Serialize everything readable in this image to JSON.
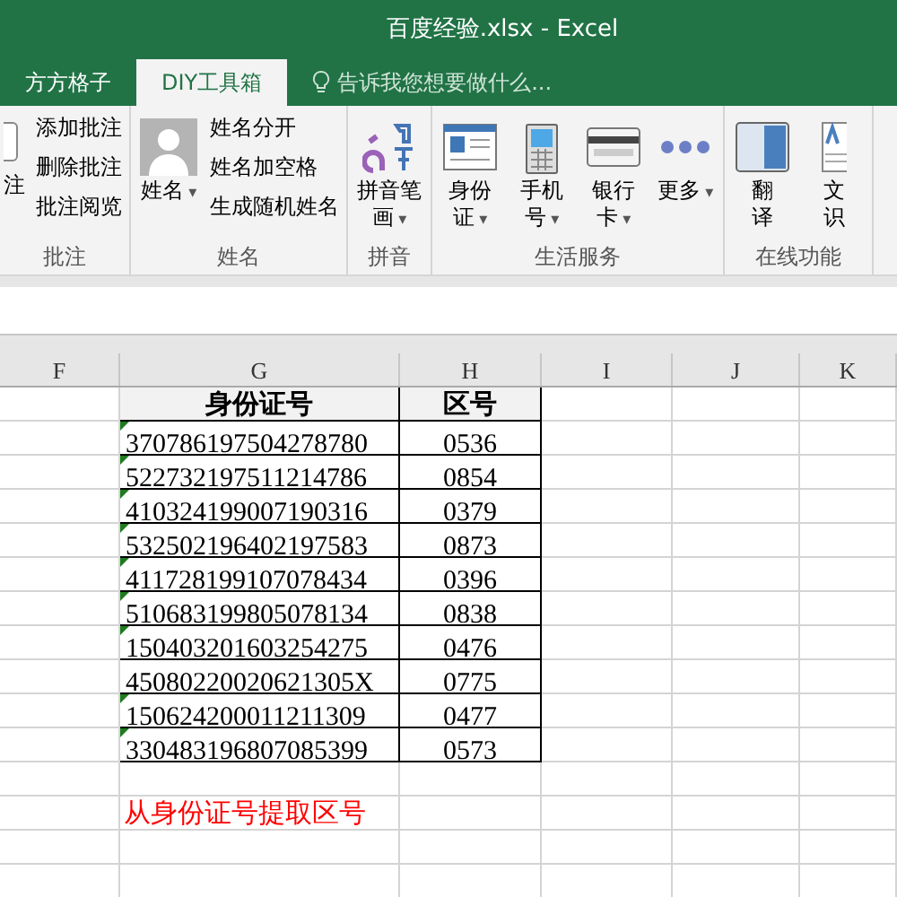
{
  "window": {
    "title": "百度经验.xlsx - Excel"
  },
  "tabs": [
    {
      "label": "方方格子",
      "selected": false
    },
    {
      "label": "DIY工具箱",
      "selected": true
    }
  ],
  "tell_me": {
    "placeholder": "告诉我您想要做什么..."
  },
  "ribbon": {
    "groups": [
      {
        "label": "批注",
        "items": [
          {
            "kind": "partial",
            "lines": [
              "注"
            ]
          },
          {
            "kind": "small",
            "label": "添加批注"
          },
          {
            "kind": "small",
            "label": "删除批注"
          },
          {
            "kind": "small",
            "label": "批注阅览"
          }
        ]
      },
      {
        "label": "姓名",
        "items": [
          {
            "kind": "avatar",
            "lines": [
              "姓名"
            ],
            "caret": "▾"
          },
          {
            "kind": "small",
            "label": "姓名分开"
          },
          {
            "kind": "small",
            "label": "姓名加空格"
          },
          {
            "kind": "small",
            "label": "生成随机姓名"
          }
        ]
      },
      {
        "label": "拼音",
        "items": [
          {
            "kind": "pinyin",
            "lines": [
              "拼音笔",
              "画"
            ],
            "caret": "▾"
          }
        ]
      },
      {
        "label": "生活服务",
        "items": [
          {
            "kind": "idcard",
            "lines": [
              "身份",
              "证"
            ],
            "caret": "▾"
          },
          {
            "kind": "phone",
            "lines": [
              "手机",
              "号"
            ],
            "caret": "▾"
          },
          {
            "kind": "bankcard",
            "lines": [
              "银行",
              "卡"
            ],
            "caret": "▾"
          },
          {
            "kind": "more",
            "lines": [
              "更多"
            ],
            "caret": "▾"
          }
        ]
      },
      {
        "label": "在线功能",
        "items": [
          {
            "kind": "translate",
            "lines": [
              "翻",
              "译"
            ]
          },
          {
            "kind": "doc",
            "lines": [
              "文",
              "识"
            ]
          }
        ]
      }
    ]
  },
  "sheet": {
    "columns": [
      "F",
      "G",
      "H",
      "I",
      "J",
      "K"
    ],
    "header": [
      "身份证号",
      "区号"
    ],
    "rows": [
      {
        "id": "370786197504278780",
        "area": "0536",
        "flagged": true
      },
      {
        "id": "522732197511214786",
        "area": "0854",
        "flagged": true
      },
      {
        "id": "410324199007190316",
        "area": "0379",
        "flagged": true
      },
      {
        "id": "532502196402197583",
        "area": "0873",
        "flagged": true
      },
      {
        "id": "411728199107078434",
        "area": "0396",
        "flagged": true
      },
      {
        "id": "510683199805078134",
        "area": "0838",
        "flagged": true
      },
      {
        "id": "150403201603254275",
        "area": "0476",
        "flagged": true
      },
      {
        "id": "45080220020621305X",
        "area": "0775",
        "flagged": false
      },
      {
        "id": "150624200011211309",
        "area": "0477",
        "flagged": true
      },
      {
        "id": "330483196807085399",
        "area": "0573",
        "flagged": true
      }
    ],
    "note": "从身份证号提取区号"
  }
}
